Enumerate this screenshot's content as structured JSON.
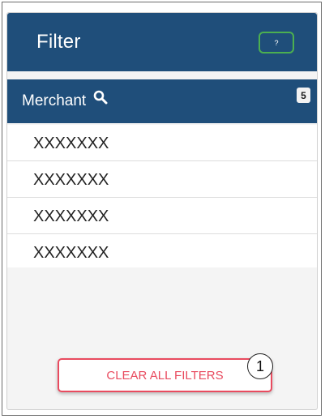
{
  "header": {
    "title": "Filter",
    "help_label": "?"
  },
  "merchant_section": {
    "label": "Merchant",
    "icon": "search-icon",
    "count": "5"
  },
  "merchants": [
    {
      "label": "XXXXXXX"
    },
    {
      "label": "XXXXXXX"
    },
    {
      "label": "XXXXXXX"
    },
    {
      "label": "XXXXXXX"
    }
  ],
  "actions": {
    "clear_label": "CLEAR ALL FILTERS"
  },
  "annotation": {
    "step": "1"
  },
  "colors": {
    "header_bg": "#1f4e7a",
    "help_border": "#4caf50",
    "clear_accent": "#e94b5f"
  }
}
